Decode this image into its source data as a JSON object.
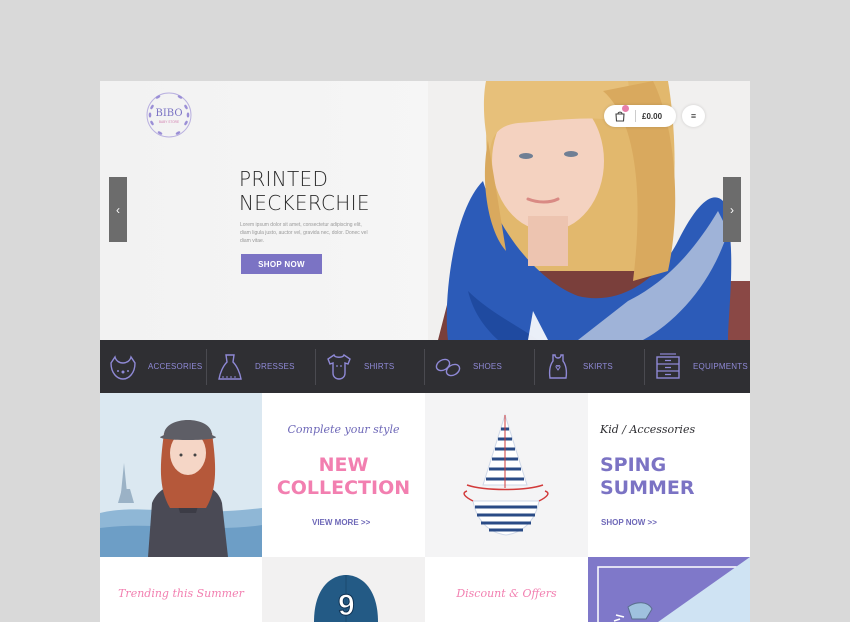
{
  "logo": {
    "brand": "BIBO",
    "tagline": "BABY STORE"
  },
  "hero": {
    "title_line1": "PRINTED",
    "title_line2": "NECKERCHIE",
    "body": "Lorem ipsum dolor sit amet, consectetur adipiscing elit, diam ligula justo, auctor vel, gravida nec, dolor. Donec vel diam vitae.",
    "cta": "SHOP NOW",
    "prev_icon": "chevron-left-icon",
    "next_icon": "chevron-right-icon"
  },
  "header": {
    "cart_amount": "£0.00",
    "cart_icon": "shopping-bag-icon",
    "menu_icon": "hamburger-icon"
  },
  "categories": [
    {
      "label": "ACCESORIES",
      "icon": "bib-icon"
    },
    {
      "label": "DRESSES",
      "icon": "dress-icon"
    },
    {
      "label": "SHIRTS",
      "icon": "onesie-icon"
    },
    {
      "label": "SHOES",
      "icon": "baby-shoes-icon"
    },
    {
      "label": "SKIRTS",
      "icon": "romper-icon"
    },
    {
      "label": "EQUIPMENTS",
      "icon": "dresser-icon"
    }
  ],
  "tiles": {
    "new_collection": {
      "kicker": "Complete your style",
      "line1": "NEW",
      "line2": "COLLECTION",
      "link": "VIEW MORE >>"
    },
    "summer": {
      "kicker": "Kid / Accessories",
      "line1": "SPING",
      "line2": "SUMMER",
      "link": "SHOP NOW >>"
    },
    "trending": {
      "kicker": "Trending this Summer"
    },
    "discount": {
      "kicker": "Discount & Offers"
    },
    "cap_number": "9"
  },
  "colors": {
    "accent": "#7b73c4",
    "pink": "#f27fb0",
    "dark_bar": "#2f2f33",
    "category_text": "#8f89d6"
  }
}
